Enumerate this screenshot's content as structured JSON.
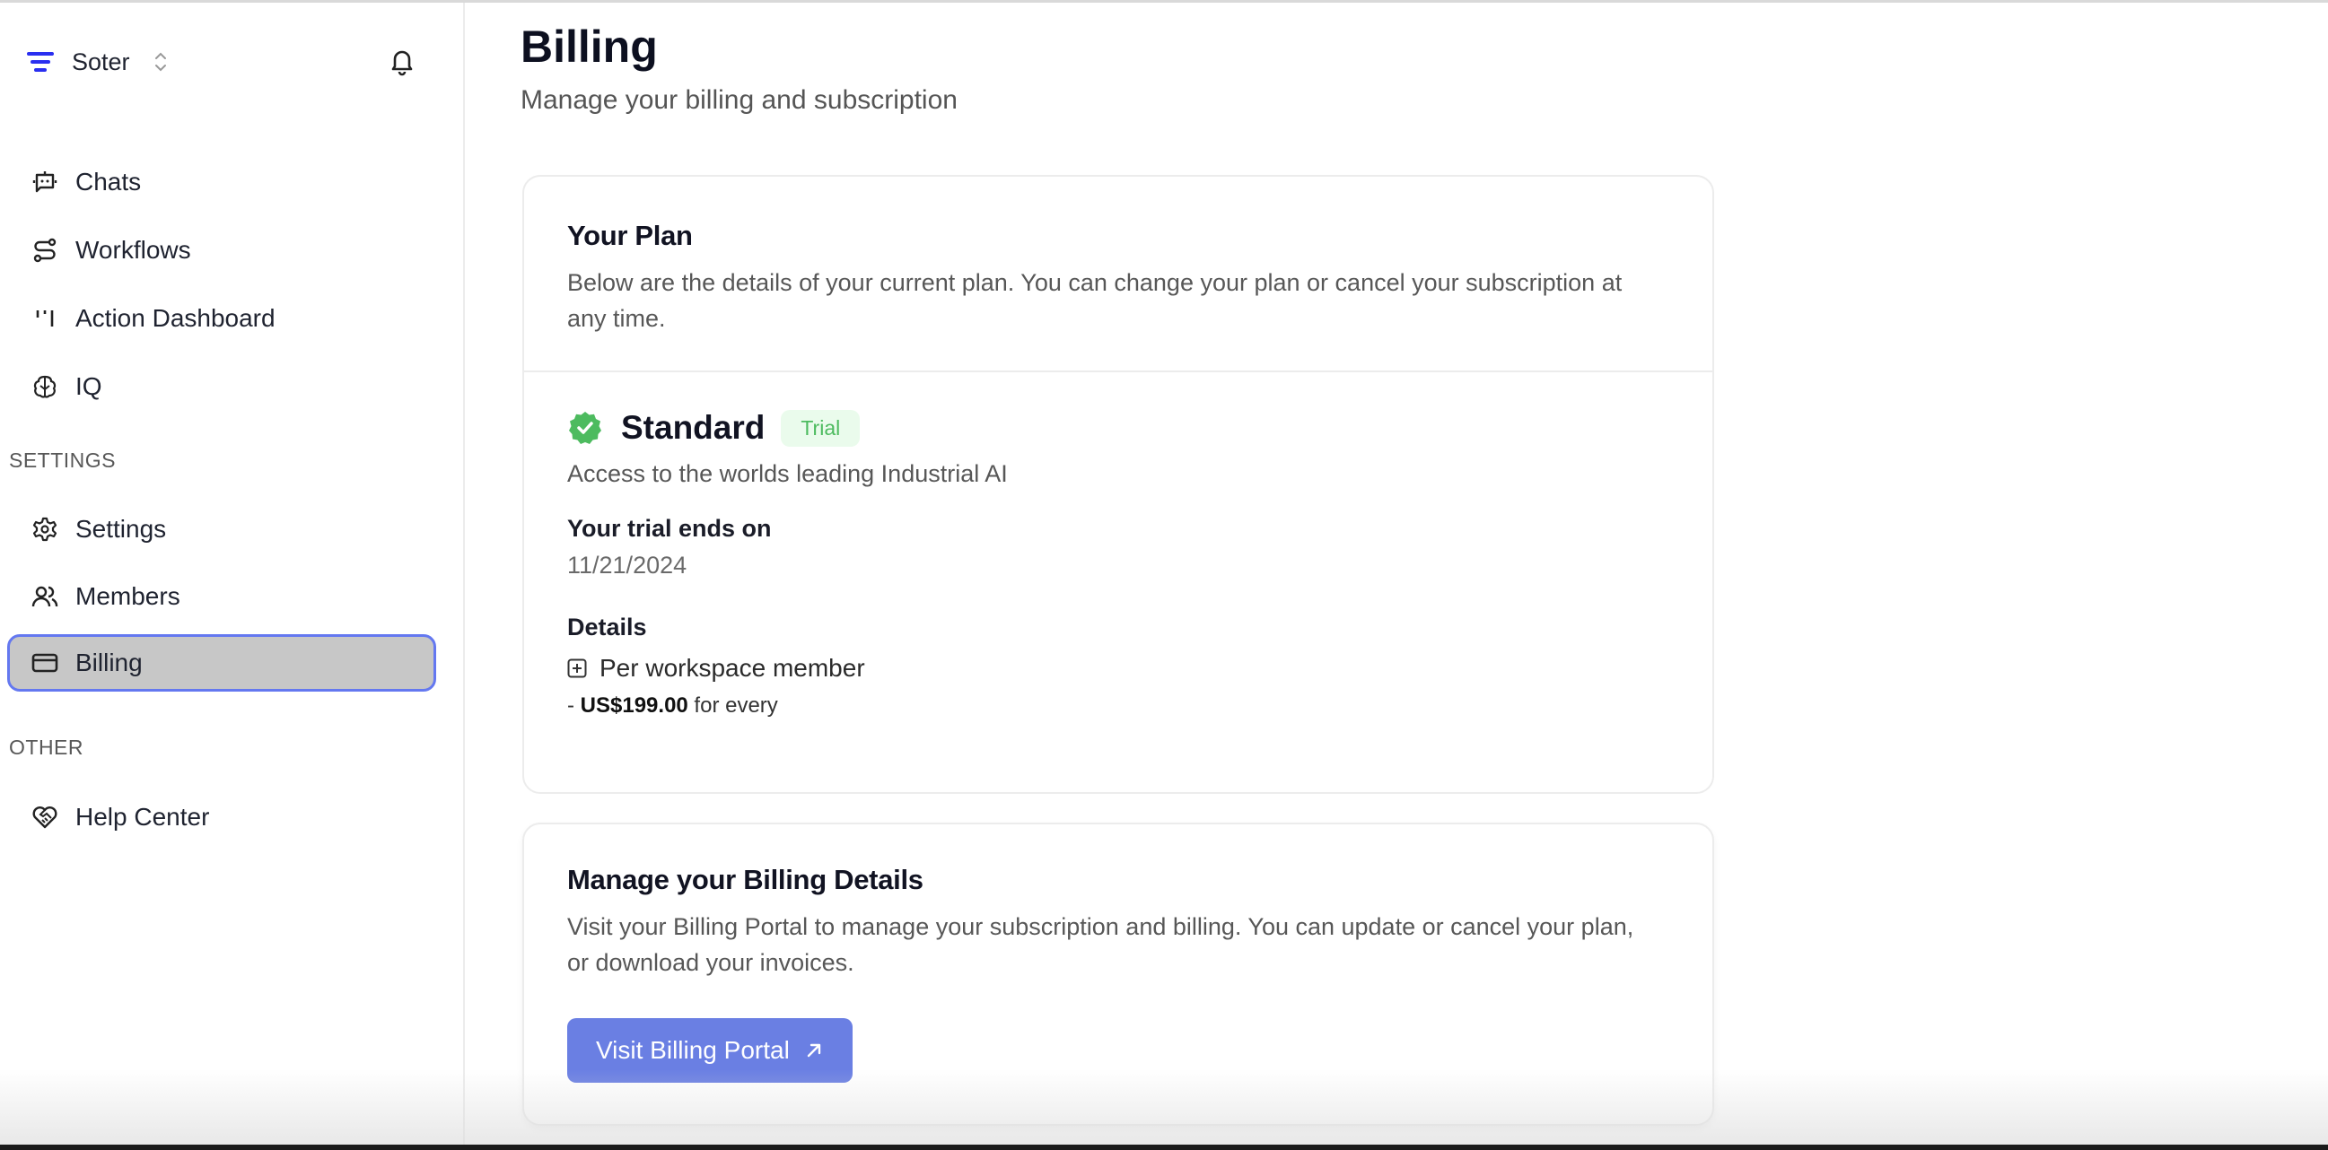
{
  "workspace": {
    "name": "Soter"
  },
  "colors": {
    "accent": "#6a7fe3",
    "active_border": "#6478f0",
    "active_bg": "#c7c7c7",
    "logo": "#2a2ff0",
    "success": "#4dbb5f",
    "success_bg": "#eafbec"
  },
  "sidebar": {
    "main_items": [
      {
        "label": "Chats",
        "icon": "bot-icon"
      },
      {
        "label": "Workflows",
        "icon": "route-icon"
      },
      {
        "label": "Action Dashboard",
        "icon": "kanban-icon"
      },
      {
        "label": "IQ",
        "icon": "brain-icon"
      }
    ],
    "settings_section": "SETTINGS",
    "settings_items": [
      {
        "label": "Settings",
        "icon": "gear-icon"
      },
      {
        "label": "Members",
        "icon": "users-icon"
      },
      {
        "label": "Billing",
        "icon": "credit-card-icon",
        "active": true
      }
    ],
    "other_section": "OTHER",
    "other_items": [
      {
        "label": "Help Center",
        "icon": "handshake-heart-icon"
      }
    ]
  },
  "page": {
    "title": "Billing",
    "subtitle": "Manage your billing and subscription"
  },
  "plan_card": {
    "title": "Your Plan",
    "description": "Below are the details of your current plan. You can change your plan or cancel your subscription at any time.",
    "plan_name": "Standard",
    "badge": "Trial",
    "tagline": "Access to the worlds leading Industrial AI",
    "trial_label": "Your trial ends on",
    "trial_end": "11/21/2024",
    "details_label": "Details",
    "detail_item": "Per workspace member",
    "price_prefix": "- ",
    "price": "US$199.00",
    "price_suffix": " for every"
  },
  "manage_card": {
    "title": "Manage your Billing Details",
    "description": "Visit your Billing Portal to manage your subscription and billing. You can update or cancel your plan, or download your invoices.",
    "button_label": "Visit Billing Portal"
  }
}
